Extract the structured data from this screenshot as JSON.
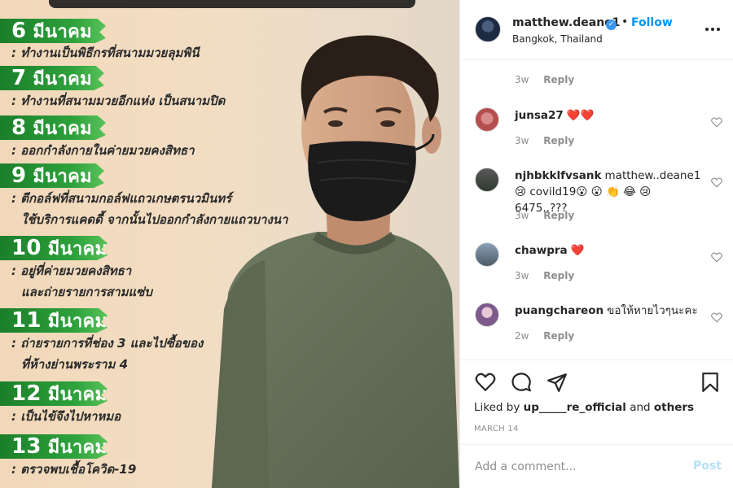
{
  "post_image": {
    "timeline": [
      {
        "day": "6",
        "month": "มีนาคม",
        "lines": [
          ": ทำงานเป็นพิธีกรที่สนามมวยลุมพินี"
        ]
      },
      {
        "day": "7",
        "month": "มีนาคม",
        "lines": [
          ":  ทำงานที่สนามมวยอีกแห่ง เป็นสนามปิด"
        ]
      },
      {
        "day": "8",
        "month": "มีนาคม",
        "lines": [
          ": ออกกำลังกายในค่ายมวยคงสิทธา"
        ]
      },
      {
        "day": "9",
        "month": "มีนาคม",
        "lines": [
          ": ตีกอล์ฟที่สนามกอล์ฟแถวเกษตรนวมินทร์",
          "ใช้บริการแคดดี้ จากนั้นไปออกกำลังกายแถวบางนา"
        ]
      },
      {
        "day": "10",
        "month": "มีนาคม",
        "lines": [
          ": อยู่ที่ค่ายมวยคงสิทธา",
          "และถ่ายรายการสามแซ่บ"
        ]
      },
      {
        "day": "11",
        "month": "มีนาคม",
        "lines": [
          ": ถ่ายรายการที่ช่อง 3 และไปซื้อของ",
          "ที่ห้างย่านพระราม 4"
        ]
      },
      {
        "day": "12",
        "month": "มีนาคม",
        "lines": [
          ": เป็นไข้จึงไปหาหมอ"
        ]
      },
      {
        "day": "13",
        "month": "มีนาคม",
        "lines": [
          ": ตรวจพบเชื้อโควิด-19"
        ]
      }
    ]
  },
  "header": {
    "username": "matthew.deane1",
    "verified_icon": "verified-badge-icon",
    "separator": "•",
    "follow_label": "Follow",
    "location": "Bangkok, Thailand"
  },
  "comments": [
    {
      "user": "",
      "text": "",
      "time": "3w",
      "reply": "Reply",
      "partial": true
    },
    {
      "user": "junsa27",
      "text": "❤️❤️",
      "time": "3w",
      "reply": "Reply"
    },
    {
      "user": "njhbkklfvsank",
      "text": "matthew..deane1😢 covild19😮 😮 👏 😂 😢 6475..???",
      "time": "3w",
      "reply": "Reply"
    },
    {
      "user": "chawpra",
      "text": "❤️",
      "time": "3w",
      "reply": "Reply"
    },
    {
      "user": "puangchareon",
      "text": "ขอให้หายไวๆนะคะ",
      "time": "2w",
      "reply": "Reply"
    }
  ],
  "actions": {
    "likes_prefix": "Liked by ",
    "likes_user": "up_____re_official",
    "likes_and": " and ",
    "likes_others": "others",
    "date": "MARCH 14"
  },
  "add_comment": {
    "placeholder": "Add a comment...",
    "post_label": "Post"
  },
  "colors": {
    "accent": "#0095f6",
    "ribbon_green": "#2ea23c",
    "post_disabled": "#b2dffc"
  }
}
